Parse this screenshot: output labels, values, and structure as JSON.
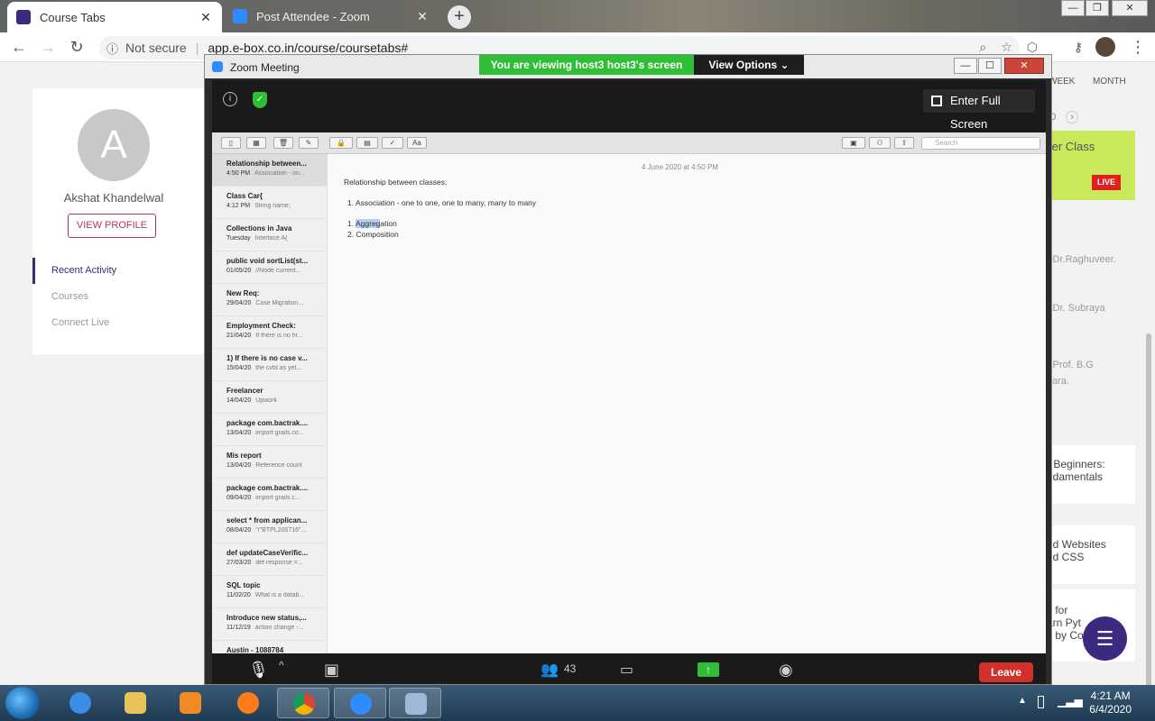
{
  "browser": {
    "tabs": [
      {
        "title": "Course Tabs",
        "favicon_color": "#3d2a80",
        "active": true
      },
      {
        "title": "Post Attendee - Zoom",
        "favicon_color": "#2d8cff",
        "active": false
      }
    ],
    "security_label": "Not secure",
    "url": "app.e-box.co.in/course/coursetabs#"
  },
  "page": {
    "avatar_letter": "A",
    "user_name": "Akshat Khandelwal",
    "view_profile_label": "VIEW PROFILE",
    "nav": [
      "Recent Activity",
      "Courses",
      "Connect Live"
    ],
    "calendar_tabs": [
      "WEEK",
      "MONTH"
    ],
    "date_fragment": "20",
    "live_card": {
      "title": "ter Class",
      "badge": "LIVE"
    },
    "faculty": [
      "y Dr.Raghuveer.",
      "y Dr. Subraya",
      "y Prof. B.G",
      "wara."
    ],
    "course_cards": [
      {
        "line1": "r Beginners:",
        "line2": "ndamentals"
      },
      {
        "line1": "rld Websites",
        "line2": "nd CSS"
      },
      {
        "line1": "s for",
        "line2": "arn Pyt",
        "line3": "s by Co"
      }
    ],
    "accent_color": "#3d2a80"
  },
  "zoom": {
    "window_title": "Zoom Meeting",
    "viewing_banner": "You are viewing host3 host3's screen",
    "view_options_label": "View Options",
    "full_screen_label": "Enter Full Screen",
    "participant_count": "43",
    "leave_label": "Leave"
  },
  "notes_app": {
    "search_placeholder": "Search",
    "list": [
      {
        "title": "Relationship between...",
        "date": "4:50 PM",
        "preview": "Association - on..."
      },
      {
        "title": "Class Car{",
        "date": "4:12 PM",
        "preview": "String name;"
      },
      {
        "title": "Collections in Java",
        "date": "Tuesday",
        "preview": "Interface A{"
      },
      {
        "title": "public void sortList(st...",
        "date": "01/05/20",
        "preview": "//Node current..."
      },
      {
        "title": "New Req:",
        "date": "29/04/20",
        "preview": "Case Migration..."
      },
      {
        "title": "Employment Check:",
        "date": "21/04/20",
        "preview": "If there is no hr..."
      },
      {
        "title": "1) If there is no case v...",
        "date": "15/04/20",
        "preview": "the cvtd as yet..."
      },
      {
        "title": "Freelancer",
        "date": "14/04/20",
        "preview": "Upwork"
      },
      {
        "title": "package com.bactrak....",
        "date": "13/04/20",
        "preview": "import grails.co..."
      },
      {
        "title": "Mis report",
        "date": "13/04/20",
        "preview": "Reference count"
      },
      {
        "title": "package com.bactrak....",
        "date": "09/04/20",
        "preview": "import grails.c..."
      },
      {
        "title": "select * from applican...",
        "date": "08/04/20",
        "preview": "\"/\"BTPL200716\"..."
      },
      {
        "title": "def updateCaseVerific...",
        "date": "27/03/20",
        "preview": "def response =..."
      },
      {
        "title": "SQL topic",
        "date": "11/02/20",
        "preview": "What is a datab..."
      },
      {
        "title": "Introduce new status,...",
        "date": "11/12/19",
        "preview": "action change -..."
      },
      {
        "title": "Austin - 1088784",
        "date": "",
        "preview": ""
      }
    ],
    "note": {
      "date": "4 June 2020 at 4:50 PM",
      "heading": "Relationship between classes:",
      "item1": "1. Association - one to one, one to many, many to many",
      "item2_num": "1.",
      "item2_highlight": "Aggreg",
      "item2_rest": "ation",
      "item3": "2. Composition"
    }
  },
  "taskbar": {
    "time": "4:21 AM",
    "date": "6/4/2020"
  }
}
